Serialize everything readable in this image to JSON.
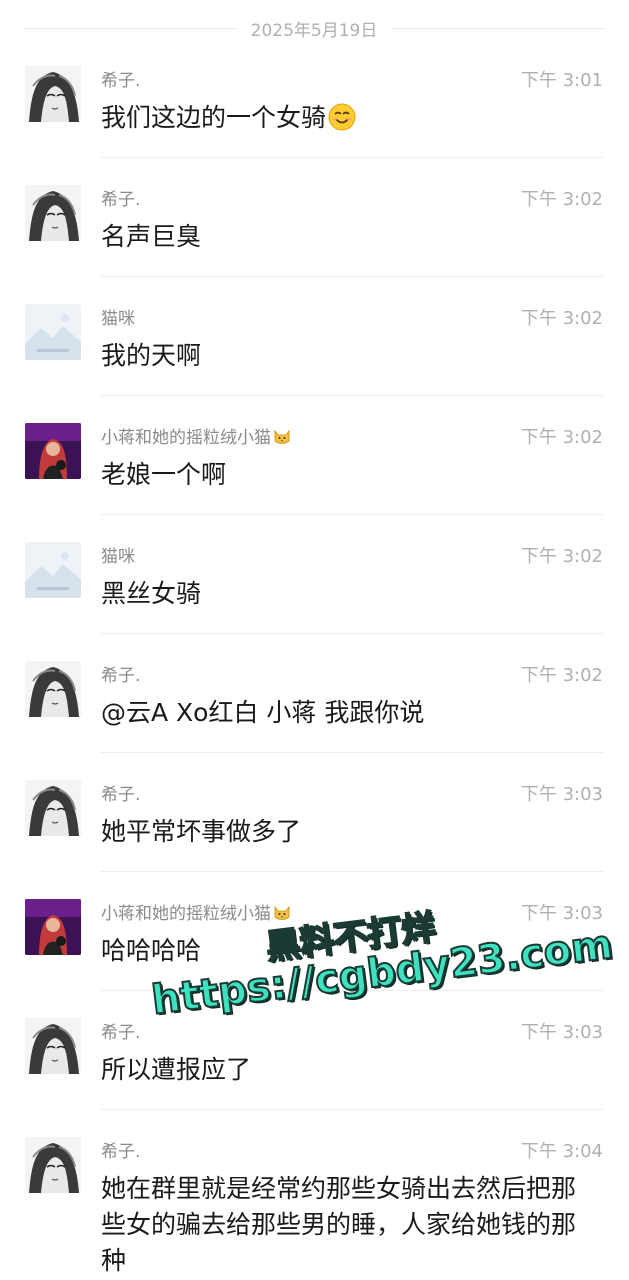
{
  "date_divider": "2025年5月19日",
  "messages": [
    {
      "sender": "希子.",
      "time": "下午 3:01",
      "text": "我们这边的一个女骑",
      "avatar": "manga-girl-avatar"
    },
    {
      "sender": "希子.",
      "time": "下午 3:02",
      "text": "名声巨臭",
      "avatar": "manga-girl-avatar"
    },
    {
      "sender": "猫咪",
      "time": "下午 3:02",
      "text": "我的天啊",
      "avatar": "image-placeholder-avatar"
    },
    {
      "sender": "小蒋和她的摇粒绒小猫",
      "time": "下午 3:02",
      "text": "老娘一个啊",
      "avatar": "purple-photo-avatar"
    },
    {
      "sender": "猫咪",
      "time": "下午 3:02",
      "text": "黑丝女骑",
      "avatar": "image-placeholder-avatar"
    },
    {
      "sender": "希子.",
      "time": "下午 3:02",
      "text": "@云A Xo红白 小蒋 我跟你说",
      "avatar": "manga-girl-avatar"
    },
    {
      "sender": "希子.",
      "time": "下午 3:03",
      "text": "她平常坏事做多了",
      "avatar": "manga-girl-avatar"
    },
    {
      "sender": "小蒋和她的摇粒绒小猫",
      "time": "下午 3:03",
      "text": "哈哈哈哈",
      "avatar": "purple-photo-avatar"
    },
    {
      "sender": "希子.",
      "time": "下午 3:03",
      "text": "所以遭报应了",
      "avatar": "manga-girl-avatar"
    },
    {
      "sender": "希子.",
      "time": "下午 3:04",
      "text": "她在群里就是经常约那些女骑出去然后把那些女的骗去给那些男的睡，人家给她钱的那种",
      "avatar": "manga-girl-avatar"
    }
  ],
  "watermark": {
    "line1": "黑料不打烊",
    "line2": "https://cgbdy23.com"
  },
  "emoji": {
    "smile": "smiling-face-emoji",
    "cat": "cat-face-emoji"
  },
  "colors": {
    "sender": "#8a8a8a",
    "time": "#b0b0b0",
    "text": "#1a1a1a",
    "watermark": "#3fe2c0"
  }
}
